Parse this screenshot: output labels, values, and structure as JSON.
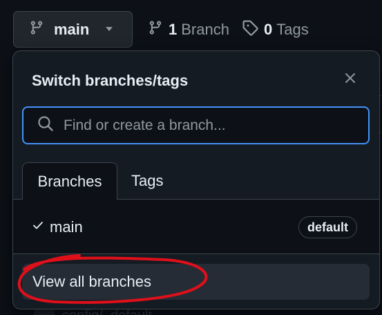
{
  "header": {
    "current_branch": "main",
    "branch_count": "1",
    "branch_label": "Branch",
    "tag_count": "0",
    "tag_label": "Tags"
  },
  "popover": {
    "title": "Switch branches/tags",
    "search_placeholder": "Find or create a branch...",
    "tabs": [
      {
        "label": "Branches",
        "selected": true
      },
      {
        "label": "Tags",
        "selected": false
      }
    ],
    "items": [
      {
        "name": "main",
        "checked": true,
        "badge": "default"
      }
    ],
    "view_all_label": "View all branches"
  },
  "background": {
    "peek_text": "config/_default"
  },
  "colors": {
    "accent_focus": "#4493f8",
    "annotation_circle": "#e0101a"
  },
  "icons": [
    "git-branch-icon",
    "triangle-down-icon",
    "tag-icon",
    "x-icon",
    "search-icon",
    "check-icon"
  ]
}
